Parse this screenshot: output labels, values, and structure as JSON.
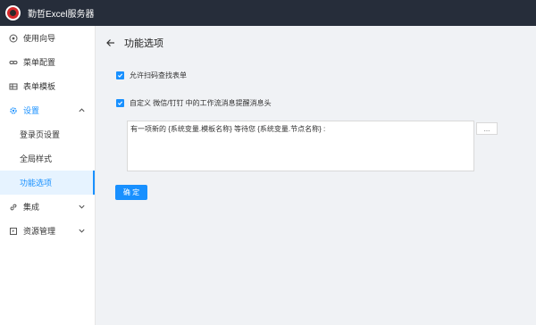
{
  "app": {
    "title": "勤哲Excel服务器"
  },
  "sidebar": {
    "items": [
      {
        "label": "使用向导",
        "icon": "settings-circle-icon"
      },
      {
        "label": "菜单配置",
        "icon": "link-icon"
      },
      {
        "label": "表单模板",
        "icon": "table-icon"
      },
      {
        "label": "设置",
        "icon": "gear-icon",
        "open": true,
        "children": [
          {
            "label": "登录页设置"
          },
          {
            "label": "全局样式"
          },
          {
            "label": "功能选项",
            "active": true
          }
        ]
      },
      {
        "label": "集成",
        "icon": "link-icon"
      },
      {
        "label": "资源管理",
        "icon": "folder-icon"
      }
    ]
  },
  "main": {
    "title": "功能选项",
    "options": [
      {
        "label": "允许扫码查找表单",
        "checked": true
      },
      {
        "label": "自定义 微信/钉钉 中的工作流消息提醒消息头",
        "checked": true
      }
    ],
    "message_template": "有一项新的 {系统变量.模板名称} 等待您 {系统变量.节点名称} :",
    "more_label": "...",
    "confirm_label": "确 定"
  },
  "colors": {
    "accent": "#1890ff",
    "topbar": "#262d3a"
  }
}
